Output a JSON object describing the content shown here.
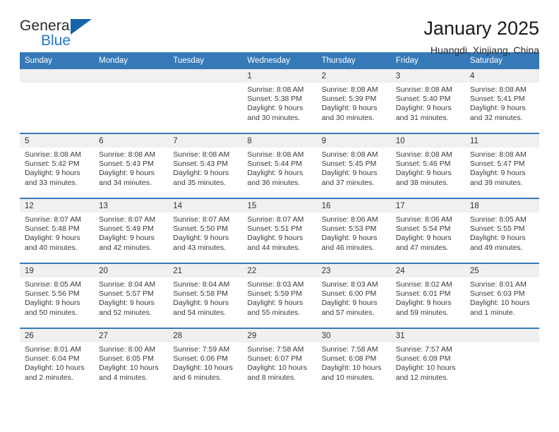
{
  "logo": {
    "word_one": "General",
    "word_two": "Blue",
    "accent_color": "#1565ad",
    "blue_text_color": "#2277c8"
  },
  "header": {
    "title": "January 2025",
    "subtitle": "Huangdi, Xinjiang, China",
    "header_bg_color": "#3679b8",
    "daynum_bg_color": "#f0f0f0"
  },
  "calendar": {
    "weekday_headers": [
      "Sunday",
      "Monday",
      "Tuesday",
      "Wednesday",
      "Thursday",
      "Friday",
      "Saturday"
    ],
    "weeks": [
      [
        {
          "day": "",
          "lines": []
        },
        {
          "day": "",
          "lines": []
        },
        {
          "day": "",
          "lines": []
        },
        {
          "day": "1",
          "lines": [
            "Sunrise: 8:08 AM",
            "Sunset: 5:38 PM",
            "Daylight: 9 hours",
            "and 30 minutes."
          ]
        },
        {
          "day": "2",
          "lines": [
            "Sunrise: 8:08 AM",
            "Sunset: 5:39 PM",
            "Daylight: 9 hours",
            "and 30 minutes."
          ]
        },
        {
          "day": "3",
          "lines": [
            "Sunrise: 8:08 AM",
            "Sunset: 5:40 PM",
            "Daylight: 9 hours",
            "and 31 minutes."
          ]
        },
        {
          "day": "4",
          "lines": [
            "Sunrise: 8:08 AM",
            "Sunset: 5:41 PM",
            "Daylight: 9 hours",
            "and 32 minutes."
          ]
        }
      ],
      [
        {
          "day": "5",
          "lines": [
            "Sunrise: 8:08 AM",
            "Sunset: 5:42 PM",
            "Daylight: 9 hours",
            "and 33 minutes."
          ]
        },
        {
          "day": "6",
          "lines": [
            "Sunrise: 8:08 AM",
            "Sunset: 5:43 PM",
            "Daylight: 9 hours",
            "and 34 minutes."
          ]
        },
        {
          "day": "7",
          "lines": [
            "Sunrise: 8:08 AM",
            "Sunset: 5:43 PM",
            "Daylight: 9 hours",
            "and 35 minutes."
          ]
        },
        {
          "day": "8",
          "lines": [
            "Sunrise: 8:08 AM",
            "Sunset: 5:44 PM",
            "Daylight: 9 hours",
            "and 36 minutes."
          ]
        },
        {
          "day": "9",
          "lines": [
            "Sunrise: 8:08 AM",
            "Sunset: 5:45 PM",
            "Daylight: 9 hours",
            "and 37 minutes."
          ]
        },
        {
          "day": "10",
          "lines": [
            "Sunrise: 8:08 AM",
            "Sunset: 5:46 PM",
            "Daylight: 9 hours",
            "and 38 minutes."
          ]
        },
        {
          "day": "11",
          "lines": [
            "Sunrise: 8:08 AM",
            "Sunset: 5:47 PM",
            "Daylight: 9 hours",
            "and 39 minutes."
          ]
        }
      ],
      [
        {
          "day": "12",
          "lines": [
            "Sunrise: 8:07 AM",
            "Sunset: 5:48 PM",
            "Daylight: 9 hours",
            "and 40 minutes."
          ]
        },
        {
          "day": "13",
          "lines": [
            "Sunrise: 8:07 AM",
            "Sunset: 5:49 PM",
            "Daylight: 9 hours",
            "and 42 minutes."
          ]
        },
        {
          "day": "14",
          "lines": [
            "Sunrise: 8:07 AM",
            "Sunset: 5:50 PM",
            "Daylight: 9 hours",
            "and 43 minutes."
          ]
        },
        {
          "day": "15",
          "lines": [
            "Sunrise: 8:07 AM",
            "Sunset: 5:51 PM",
            "Daylight: 9 hours",
            "and 44 minutes."
          ]
        },
        {
          "day": "16",
          "lines": [
            "Sunrise: 8:06 AM",
            "Sunset: 5:53 PM",
            "Daylight: 9 hours",
            "and 46 minutes."
          ]
        },
        {
          "day": "17",
          "lines": [
            "Sunrise: 8:06 AM",
            "Sunset: 5:54 PM",
            "Daylight: 9 hours",
            "and 47 minutes."
          ]
        },
        {
          "day": "18",
          "lines": [
            "Sunrise: 8:05 AM",
            "Sunset: 5:55 PM",
            "Daylight: 9 hours",
            "and 49 minutes."
          ]
        }
      ],
      [
        {
          "day": "19",
          "lines": [
            "Sunrise: 8:05 AM",
            "Sunset: 5:56 PM",
            "Daylight: 9 hours",
            "and 50 minutes."
          ]
        },
        {
          "day": "20",
          "lines": [
            "Sunrise: 8:04 AM",
            "Sunset: 5:57 PM",
            "Daylight: 9 hours",
            "and 52 minutes."
          ]
        },
        {
          "day": "21",
          "lines": [
            "Sunrise: 8:04 AM",
            "Sunset: 5:58 PM",
            "Daylight: 9 hours",
            "and 54 minutes."
          ]
        },
        {
          "day": "22",
          "lines": [
            "Sunrise: 8:03 AM",
            "Sunset: 5:59 PM",
            "Daylight: 9 hours",
            "and 55 minutes."
          ]
        },
        {
          "day": "23",
          "lines": [
            "Sunrise: 8:03 AM",
            "Sunset: 6:00 PM",
            "Daylight: 9 hours",
            "and 57 minutes."
          ]
        },
        {
          "day": "24",
          "lines": [
            "Sunrise: 8:02 AM",
            "Sunset: 6:01 PM",
            "Daylight: 9 hours",
            "and 59 minutes."
          ]
        },
        {
          "day": "25",
          "lines": [
            "Sunrise: 8:01 AM",
            "Sunset: 6:03 PM",
            "Daylight: 10 hours",
            "and 1 minute."
          ]
        }
      ],
      [
        {
          "day": "26",
          "lines": [
            "Sunrise: 8:01 AM",
            "Sunset: 6:04 PM",
            "Daylight: 10 hours",
            "and 2 minutes."
          ]
        },
        {
          "day": "27",
          "lines": [
            "Sunrise: 8:00 AM",
            "Sunset: 6:05 PM",
            "Daylight: 10 hours",
            "and 4 minutes."
          ]
        },
        {
          "day": "28",
          "lines": [
            "Sunrise: 7:59 AM",
            "Sunset: 6:06 PM",
            "Daylight: 10 hours",
            "and 6 minutes."
          ]
        },
        {
          "day": "29",
          "lines": [
            "Sunrise: 7:58 AM",
            "Sunset: 6:07 PM",
            "Daylight: 10 hours",
            "and 8 minutes."
          ]
        },
        {
          "day": "30",
          "lines": [
            "Sunrise: 7:58 AM",
            "Sunset: 6:08 PM",
            "Daylight: 10 hours",
            "and 10 minutes."
          ]
        },
        {
          "day": "31",
          "lines": [
            "Sunrise: 7:57 AM",
            "Sunset: 6:09 PM",
            "Daylight: 10 hours",
            "and 12 minutes."
          ]
        },
        {
          "day": "",
          "lines": []
        }
      ]
    ]
  }
}
